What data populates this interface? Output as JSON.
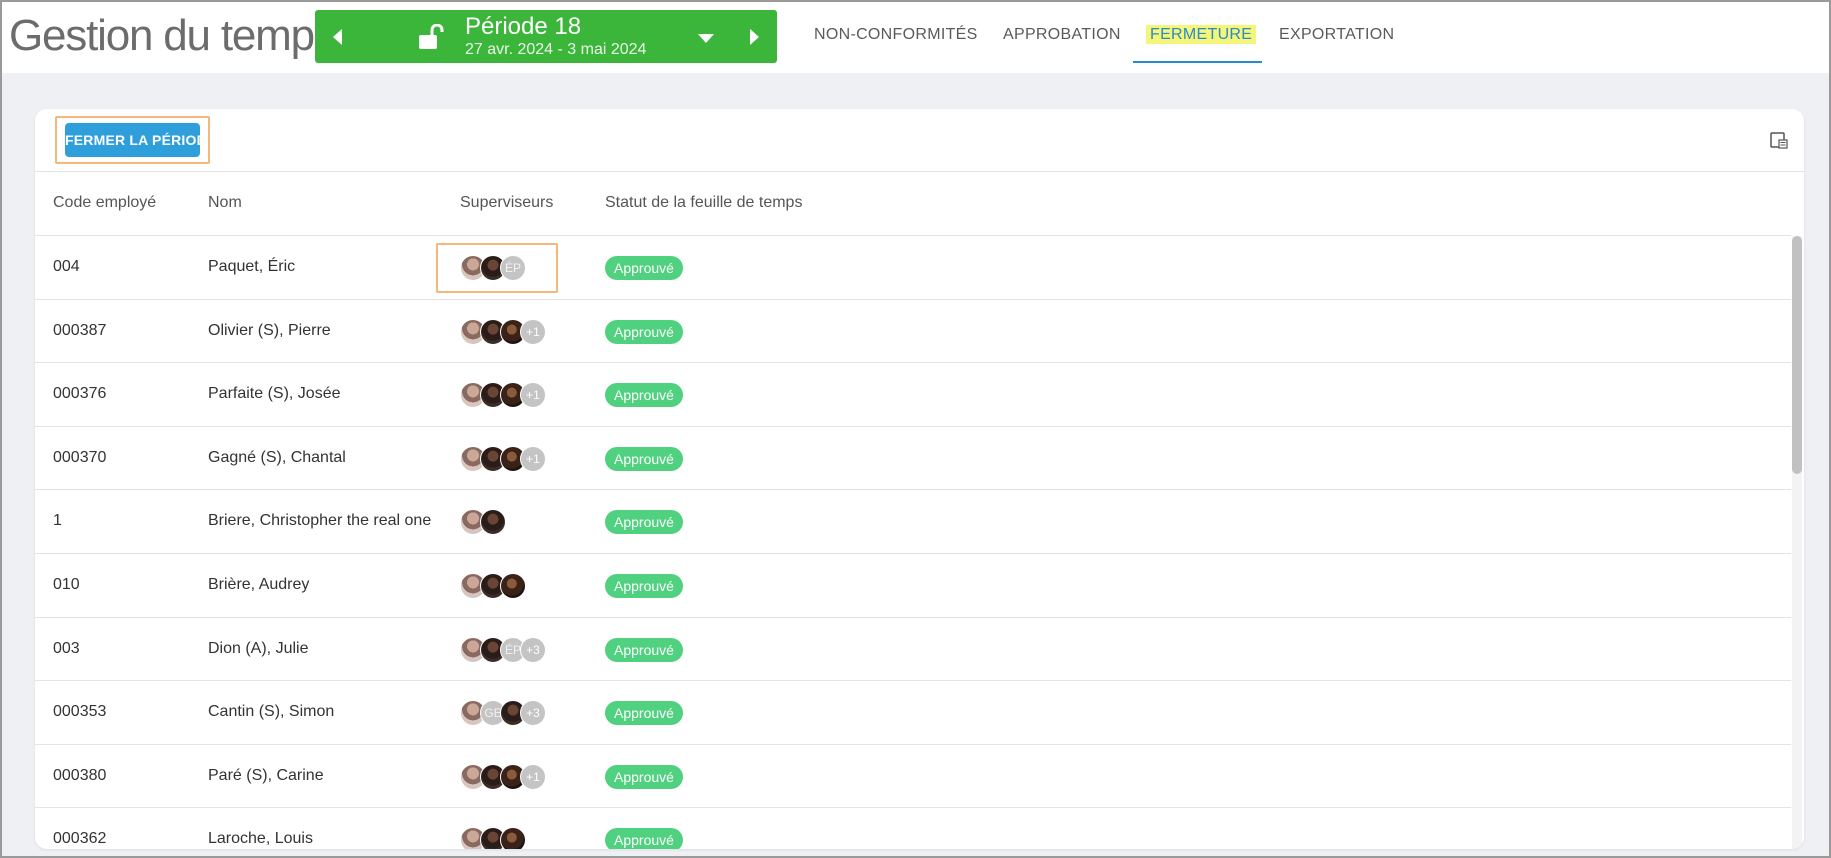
{
  "app": {
    "title": "Gestion du temps"
  },
  "period": {
    "name": "Période 18",
    "dates": "27 avr. 2024 - 3 mai 2024"
  },
  "tabs": [
    {
      "label": "NON-CONFORMITÉS"
    },
    {
      "label": "APPROBATION"
    },
    {
      "label": "FERMETURE",
      "active": true
    },
    {
      "label": "EXPORTATION"
    }
  ],
  "toolbar": {
    "close_period_label": "FERMER LA PÉRIODE"
  },
  "table": {
    "headers": [
      "Code employé",
      "Nom",
      "Superviseurs",
      "Statut de la feuille de temps"
    ],
    "rows": [
      {
        "code": "004",
        "name": "Paquet, Éric",
        "supervisors": [
          "photo-a",
          "photo-b",
          "ÉP"
        ],
        "status": "Approuvé"
      },
      {
        "code": "000387",
        "name": "Olivier (S), Pierre",
        "supervisors": [
          "photo-a",
          "photo-b",
          "photo-c",
          "+1"
        ],
        "status": "Approuvé"
      },
      {
        "code": "000376",
        "name": "Parfaite (S), Josée",
        "supervisors": [
          "photo-a",
          "photo-b",
          "photo-c",
          "+1"
        ],
        "status": "Approuvé"
      },
      {
        "code": "000370",
        "name": "Gagné (S), Chantal",
        "supervisors": [
          "photo-a",
          "photo-b",
          "photo-c",
          "+1"
        ],
        "status": "Approuvé"
      },
      {
        "code": "1",
        "name": "Briere, Christopher the real one",
        "supervisors": [
          "photo-a",
          "photo-b"
        ],
        "status": "Approuvé"
      },
      {
        "code": "010",
        "name": "Brière, Audrey",
        "supervisors": [
          "photo-a",
          "photo-b",
          "photo-c"
        ],
        "status": "Approuvé"
      },
      {
        "code": "003",
        "name": "Dion (A), Julie",
        "supervisors": [
          "photo-a",
          "photo-b",
          "ÉP",
          "+3"
        ],
        "status": "Approuvé"
      },
      {
        "code": "000353",
        "name": "Cantin (S), Simon",
        "supervisors": [
          "photo-a",
          "GE",
          "photo-b",
          "+3"
        ],
        "status": "Approuvé"
      },
      {
        "code": "000380",
        "name": "Paré (S), Carine",
        "supervisors": [
          "photo-a",
          "photo-b",
          "photo-c",
          "+1"
        ],
        "status": "Approuvé"
      },
      {
        "code": "000362",
        "name": "Laroche, Louis",
        "supervisors": [
          "photo-a",
          "photo-b",
          "photo-c"
        ],
        "status": "Approuvé"
      }
    ]
  },
  "colors": {
    "period_bg": "#3cb63a",
    "primary_button": "#2f9fdc",
    "active_tab": "#2a8bc9",
    "status_approved": "#4fd17f",
    "highlight_box": "#f5b77a"
  }
}
